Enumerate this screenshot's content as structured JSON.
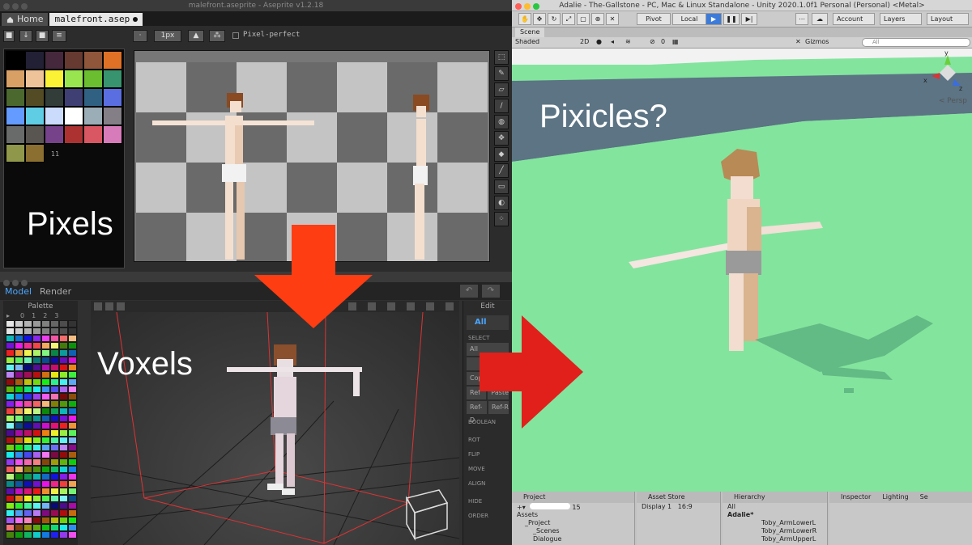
{
  "aseprite": {
    "window_title": "malefront.aseprite - Aseprite v1.2.18",
    "tabs": [
      {
        "label": "Home"
      },
      {
        "label": "malefront.asep"
      }
    ],
    "toolbar": {
      "brush_size": "1px",
      "pixel_perfect_label": "Pixel-perfect"
    },
    "palette_count": "11",
    "overlay_label": "Pixels"
  },
  "voxel": {
    "menu": {
      "model": "Model",
      "render": "Render"
    },
    "palette_title": "Palette",
    "palette_header": [
      "0",
      "1",
      "2",
      "3"
    ],
    "overlay_label": "Voxels",
    "edit_panel": {
      "title": "Edit",
      "all": "All",
      "select_section": "SELECT",
      "buttons": [
        "All",
        "Cop"
      ],
      "ref_row": [
        "Ref",
        "Paste"
      ],
      "refd_row": [
        "Ref-D",
        "Ref-R"
      ],
      "boolean_section": "BOOLEAN",
      "sections": [
        "ROT",
        "FLIP",
        "MOVE",
        "ALIGN",
        "HIDE",
        "ORDER"
      ]
    }
  },
  "unity": {
    "window_title": "Adalie - The-Gallstone - PC, Mac & Linux Standalone - Unity 2020.1.0f1 Personal (Personal) <Metal>",
    "toolbar": {
      "pivot": "Pivot",
      "local": "Local",
      "account": "Account",
      "layers": "Layers",
      "layout": "Layout"
    },
    "scene_tab": "Scene",
    "scene_bar": {
      "shading": "Shaded",
      "mode_2d": "2D",
      "fx_count": "0",
      "gizmos": "Gizmos",
      "search_placeholder": "All"
    },
    "gizmo_labels": {
      "y": "y",
      "x": "x",
      "z": "z"
    },
    "persp_label": "< Persp",
    "overlay_label": "Pixicles?",
    "bottom": {
      "project_tab": "Project",
      "assets_root": "Assets",
      "assets_items": [
        "_Project",
        "_Scenes",
        "Dialogue"
      ],
      "project_search_count": "15",
      "asset_store_tab": "Asset Store",
      "display": "Display 1",
      "aspect": "16:9",
      "hierarchy_tab": "Hierarchy",
      "hierarchy_search": "All",
      "hierarchy_root": "Adalie*",
      "hierarchy_items": [
        "Toby_ArmLowerL",
        "Toby_ArmLowerR",
        "Toby_ArmUpperL"
      ],
      "inspector_tab": "Inspector",
      "lighting_tab": "Lighting",
      "services_tab": "Se"
    }
  },
  "colors": {
    "arrow_red": "#e1201b",
    "arrow_orange": "#ff3d12",
    "unity_ground": "#83e49e",
    "voxel_accent": "#4aa6ff"
  }
}
